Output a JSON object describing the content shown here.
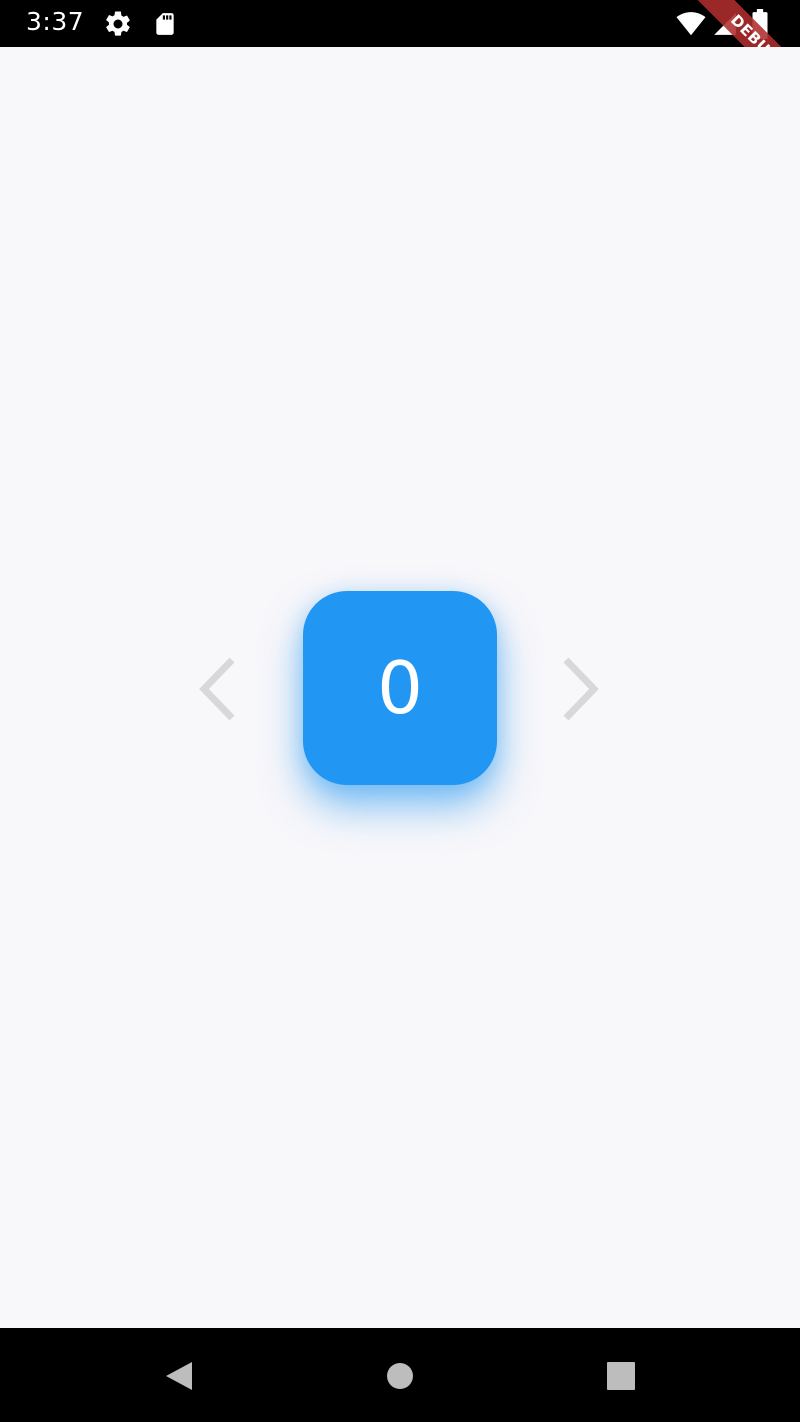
{
  "status_bar": {
    "time": "3:37",
    "icons": [
      "gear-icon",
      "sd-card-icon",
      "wifi-icon",
      "signal-icon",
      "battery-icon"
    ]
  },
  "debug_banner": {
    "label": "DEBUG",
    "color": "#b02d2d"
  },
  "counter": {
    "value": "0",
    "box_color": "#2196f3",
    "text_color": "#ffffff"
  },
  "navigation": {
    "previous_icon": "chevron-left-icon",
    "next_icon": "chevron-right-icon",
    "arrow_color": "#d8d8d8"
  },
  "system_nav": {
    "buttons": [
      "back-icon",
      "home-icon",
      "recents-icon"
    ]
  }
}
